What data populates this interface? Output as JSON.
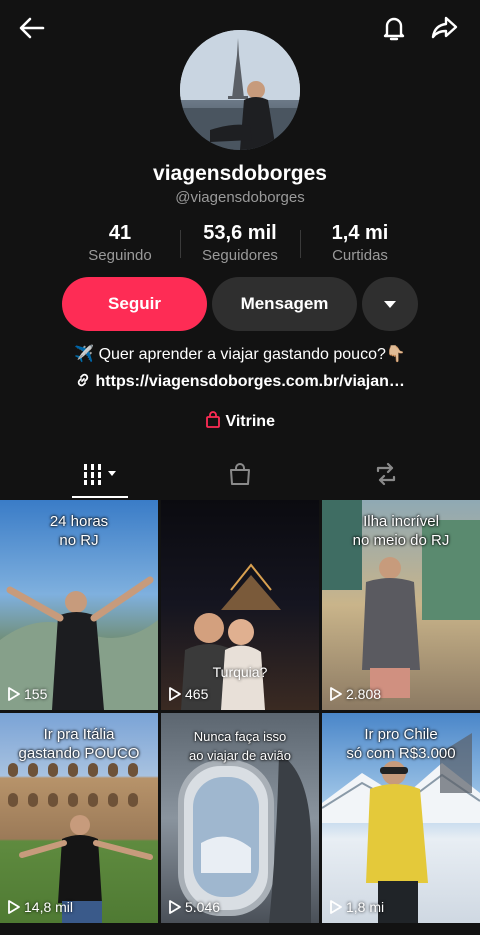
{
  "profile": {
    "username": "viagensdoborges",
    "handle": "@viagensdoborges",
    "stats": [
      {
        "value": "41",
        "label": "Seguindo"
      },
      {
        "value": "53,6 mil",
        "label": "Seguidores"
      },
      {
        "value": "1,4 mi",
        "label": "Curtidas"
      }
    ],
    "follow_label": "Seguir",
    "message_label": "Mensagem",
    "bio_prefix_emoji": "✈️",
    "bio_text": "Quer aprender a viajar gastando pouco?",
    "bio_suffix_emoji": "👇🏼",
    "link": "https://viagensdoborges.com.br/viajan…",
    "vitrine_label": "Vitrine"
  },
  "colors": {
    "accent": "#fe2c55",
    "background": "#121212",
    "button_gray": "#2f2f2f",
    "muted": "#9a9a9a"
  },
  "tabs": [
    "videos-grid-icon",
    "shop-bag-icon",
    "repost-icon"
  ],
  "videos": [
    {
      "caption": "24 horas\nno RJ",
      "overlay": "",
      "views": "155"
    },
    {
      "caption": "",
      "overlay": "Turquia?",
      "views": "465"
    },
    {
      "caption": "Ilha incrível\nno meio do RJ",
      "overlay": "",
      "views": "2.808"
    },
    {
      "caption": "Ir pra Itália\ngastando POUCO",
      "overlay": "",
      "views": "14,8 mil"
    },
    {
      "caption": "Nunca faça isso\nao viajar de avião",
      "overlay": "",
      "views": "5.046"
    },
    {
      "caption": "Ir pro Chile\nsó com R$3.000",
      "overlay": "",
      "views": "1,8 mi"
    }
  ]
}
